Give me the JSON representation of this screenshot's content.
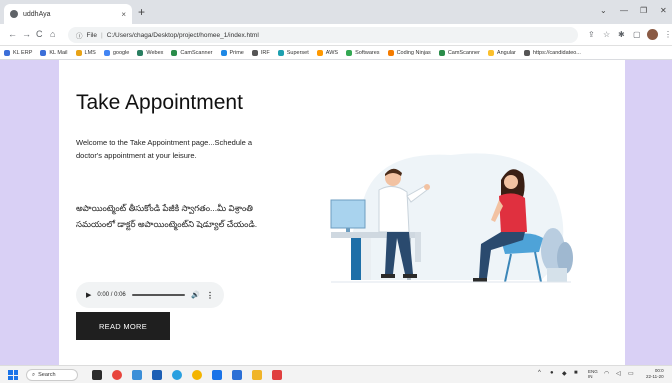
{
  "browser": {
    "tab_title": "uddhAya",
    "tab_close": "×",
    "new_tab": "+",
    "address_label": "File",
    "address": "C:/Users/chaga/Desktop/project/homee_1/index.html",
    "bookmarks": [
      {
        "label": "KL ERP",
        "color": "#3c6fd8"
      },
      {
        "label": "KL Mail",
        "color": "#3c6fd8"
      },
      {
        "label": "LMS",
        "color": "#e8a317"
      },
      {
        "label": "google",
        "color": "#4285f4"
      },
      {
        "label": "Webex",
        "color": "#2a7f62"
      },
      {
        "label": "CamScanner",
        "color": "#2a8c4a"
      },
      {
        "label": "Prime",
        "color": "#1e88e5"
      },
      {
        "label": "IRF",
        "color": "#555555"
      },
      {
        "label": "Superset",
        "color": "#1ea0b0"
      },
      {
        "label": "AWS",
        "color": "#ff9900"
      },
      {
        "label": "Softwares",
        "color": "#34a853"
      },
      {
        "label": "Coding Ninjas",
        "color": "#f57c00"
      },
      {
        "label": "CamScanner",
        "color": "#2a8c4a"
      },
      {
        "label": "Angular",
        "color": "#fbc02d"
      },
      {
        "label": "https://candidateo...",
        "color": "#555555"
      }
    ]
  },
  "page": {
    "title": "Take Appointment",
    "description": "Welcome to the Take Appointment page...Schedule a doctor's appointment at your leisure.",
    "telugu_text": "అపాయింట్మెంట్ తీసుకోండి పేజీకి స్వాగతం...మీ విశ్రాంతి సమయంలో డాక్టర్ అపాయింట్మెంట్‌ని షెడ్యూల్ చేయండి.",
    "audio": {
      "time": "0:00 / 0:06",
      "play_icon": "▶",
      "volume_icon": "🔊",
      "more_icon": "⋮"
    },
    "read_more_label": "READ MORE"
  },
  "taskbar": {
    "search_label": "Search",
    "lang": "ENG",
    "lang_sub": "IN",
    "time": "00:0",
    "date": "22-11-20"
  }
}
